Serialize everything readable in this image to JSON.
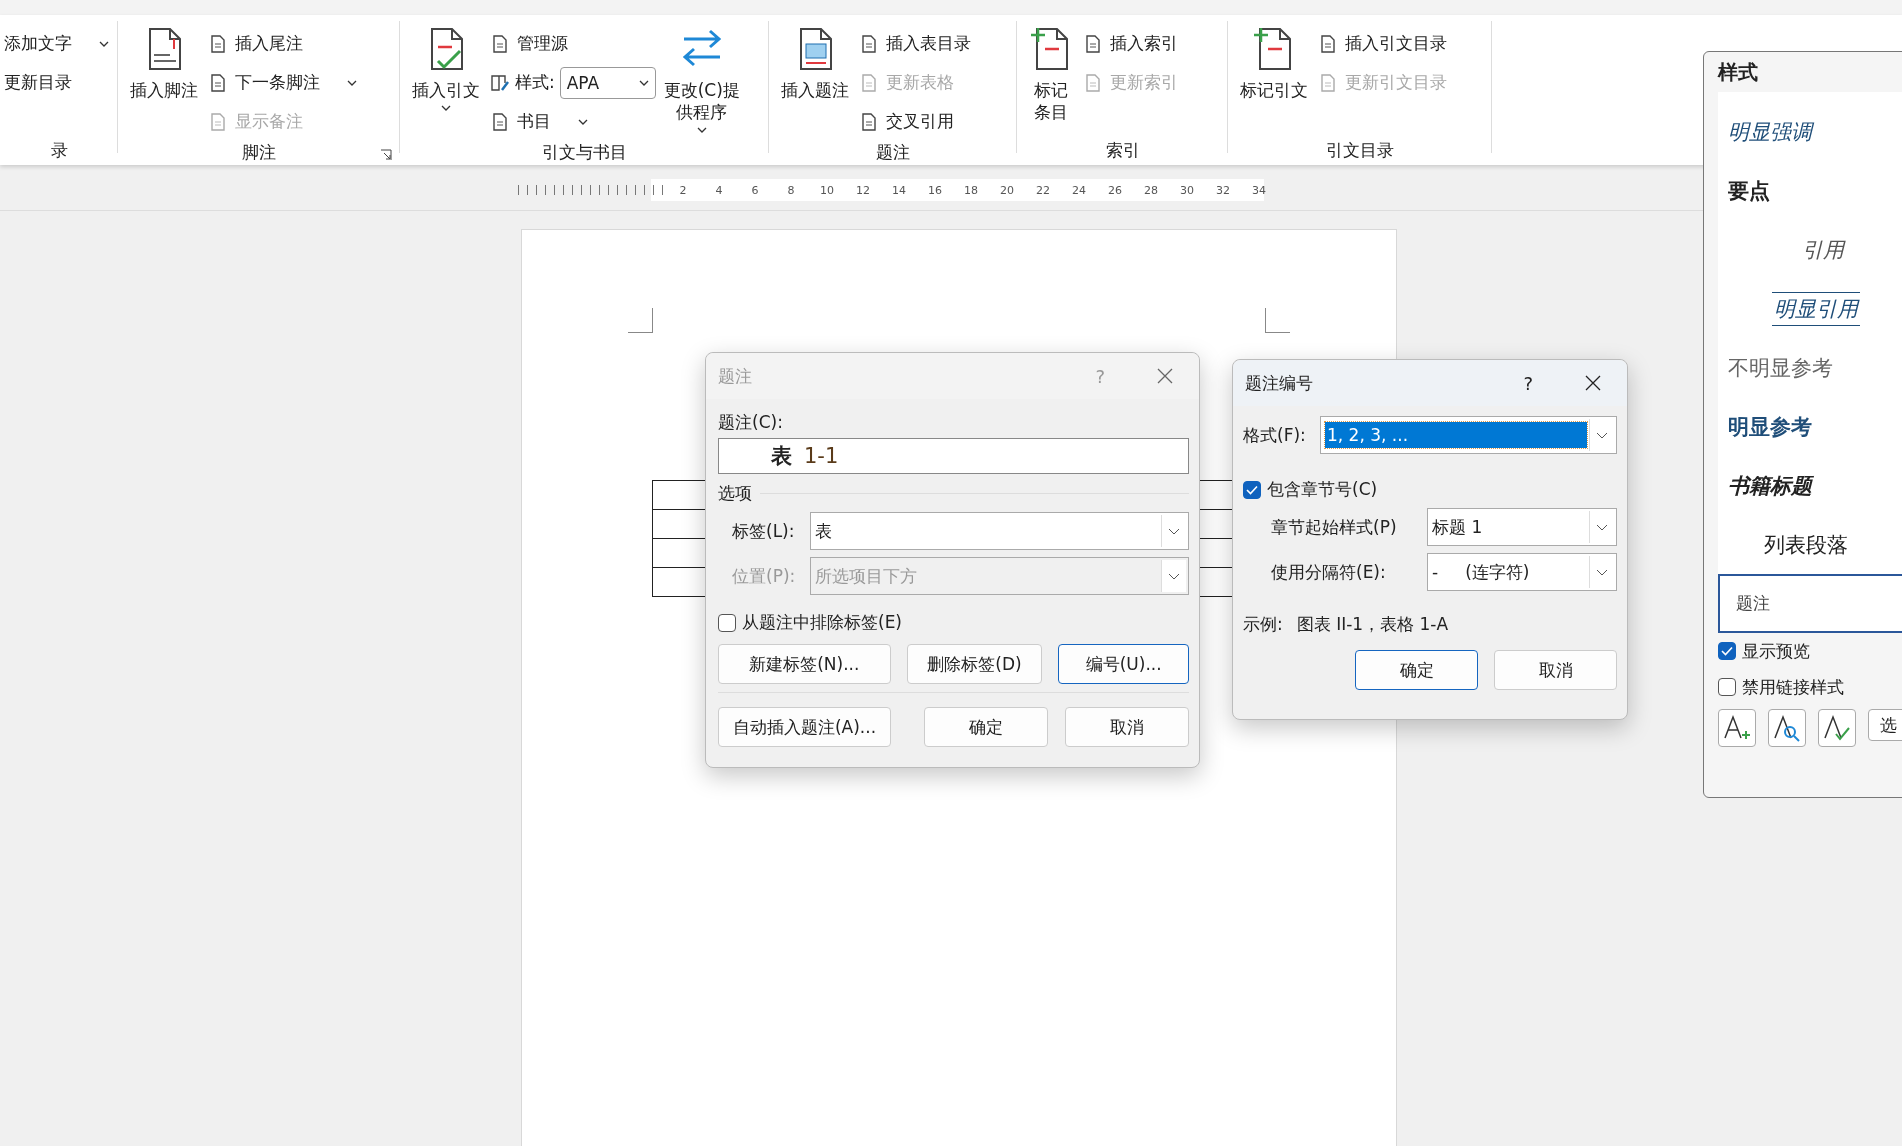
{
  "ribbon": {
    "groups": [
      {
        "label": "录",
        "items": [
          {
            "kind": "column",
            "rows": [
              {
                "kind": "text",
                "label": "添加文字",
                "caret": true,
                "disabled": false
              },
              {
                "kind": "text",
                "label": "更新目录",
                "caret": false,
                "disabled": false
              }
            ]
          }
        ],
        "launcher": false
      },
      {
        "label": "脚注",
        "items": [
          {
            "kind": "big",
            "lines": [
              "插入脚注"
            ],
            "caret": false
          },
          {
            "kind": "column",
            "rows": [
              {
                "kind": "button",
                "label": "插入尾注",
                "caret": false,
                "disabled": false
              },
              {
                "kind": "button",
                "label": "下一条脚注",
                "caret": true,
                "disabled": false
              },
              {
                "kind": "button",
                "label": "显示备注",
                "caret": false,
                "disabled": true
              }
            ]
          }
        ],
        "launcher": true
      },
      {
        "label": "引文与书目",
        "items": [
          {
            "kind": "big",
            "lines": [
              "插入引文"
            ],
            "caret": true
          },
          {
            "kind": "column",
            "rows": [
              {
                "kind": "button",
                "label": "管理源",
                "caret": false,
                "disabled": false
              },
              {
                "kind": "combo",
                "label": "样式:",
                "value": "APA"
              },
              {
                "kind": "button",
                "label": "书目",
                "caret": true,
                "disabled": false
              }
            ]
          },
          {
            "kind": "big",
            "lines": [
              "更改(C)提",
              "供程序"
            ],
            "caret": true
          }
        ],
        "launcher": false
      },
      {
        "label": "题注",
        "items": [
          {
            "kind": "big",
            "lines": [
              "插入题注"
            ],
            "caret": false
          },
          {
            "kind": "column",
            "rows": [
              {
                "kind": "button",
                "label": "插入表目录",
                "caret": false,
                "disabled": false
              },
              {
                "kind": "button",
                "label": "更新表格",
                "caret": false,
                "disabled": true
              },
              {
                "kind": "button",
                "label": "交叉引用",
                "caret": false,
                "disabled": false
              }
            ]
          }
        ],
        "launcher": false
      },
      {
        "label": "索引",
        "items": [
          {
            "kind": "big",
            "lines": [
              "标记",
              "条目"
            ],
            "caret": false
          },
          {
            "kind": "column",
            "rows": [
              {
                "kind": "button",
                "label": "插入索引",
                "caret": false,
                "disabled": false
              },
              {
                "kind": "button",
                "label": "更新索引",
                "caret": false,
                "disabled": true
              }
            ]
          }
        ],
        "launcher": false
      },
      {
        "label": "引文目录",
        "items": [
          {
            "kind": "big",
            "lines": [
              "标记引文"
            ],
            "caret": false
          },
          {
            "kind": "column",
            "rows": [
              {
                "kind": "button",
                "label": "插入引文目录",
                "caret": false,
                "disabled": false
              },
              {
                "kind": "button",
                "label": "更新引文目录",
                "caret": false,
                "disabled": true
              }
            ]
          }
        ],
        "launcher": false
      }
    ]
  },
  "ruler": {
    "numbers": [
      "2",
      "4",
      "6",
      "8",
      "10",
      "12",
      "14",
      "16",
      "18",
      "20",
      "22",
      "24",
      "26",
      "28",
      "30",
      "32",
      "34"
    ]
  },
  "caption_dialog": {
    "title": "题注",
    "active": false,
    "help": "?",
    "caption_label": "题注(C):",
    "caption_prefix": "表",
    "caption_number": "1-1",
    "options_heading": "选项",
    "fields": [
      {
        "label": "标签(L):",
        "value": "表",
        "disabled": false
      },
      {
        "label": "位置(P):",
        "value": "所选项目下方",
        "disabled": true
      }
    ],
    "exclude_label": {
      "label": "从题注中排除标签(E)",
      "checked": false
    },
    "buttons": [
      {
        "label": "新建标签(N)...",
        "default": false
      },
      {
        "label": "删除标签(D)",
        "default": false
      },
      {
        "label": "编号(U)...",
        "default": true
      }
    ],
    "bottom_buttons": [
      {
        "label": "自动插入题注(A)...",
        "default": false
      },
      {
        "label": "确定",
        "default": false
      },
      {
        "label": "取消",
        "default": false
      }
    ]
  },
  "numbering_dialog": {
    "title": "题注编号",
    "active": true,
    "help": "?",
    "format_label": "格式(F):",
    "format_value": "1, 2, 3, ...",
    "include_chapter": {
      "label": "包含章节号(C)",
      "checked": true
    },
    "fields": [
      {
        "label": "章节起始样式(P)",
        "value": "标题 1"
      },
      {
        "label": "使用分隔符(E):",
        "value": "-     (连字符)"
      }
    ],
    "example_label": "示例:",
    "example_value": "图表 II-1，表格 1-A",
    "buttons": [
      {
        "label": "确定",
        "default": true
      },
      {
        "label": "取消",
        "default": false
      }
    ]
  },
  "styles_pane": {
    "title": "样式",
    "items": [
      {
        "label": "明显强调",
        "kind": "emphasis",
        "selected": false
      },
      {
        "label": "要点",
        "kind": "strong",
        "selected": false
      },
      {
        "label": "引用",
        "kind": "quote",
        "selected": false
      },
      {
        "label": "明显引用",
        "kind": "intense-quote",
        "selected": false
      },
      {
        "label": "不明显参考",
        "kind": "subtle-ref",
        "selected": false
      },
      {
        "label": "明显参考",
        "kind": "intense-ref",
        "selected": false
      },
      {
        "label": "书籍标题",
        "kind": "book-title",
        "selected": false
      },
      {
        "label": "列表段落",
        "kind": "list-para",
        "selected": false
      },
      {
        "label": "题注",
        "kind": "caption",
        "selected": true
      }
    ],
    "options": [
      {
        "label": "显示预览",
        "checked": true
      },
      {
        "label": "禁用链接样式",
        "checked": false
      }
    ],
    "cut_button": "选"
  }
}
